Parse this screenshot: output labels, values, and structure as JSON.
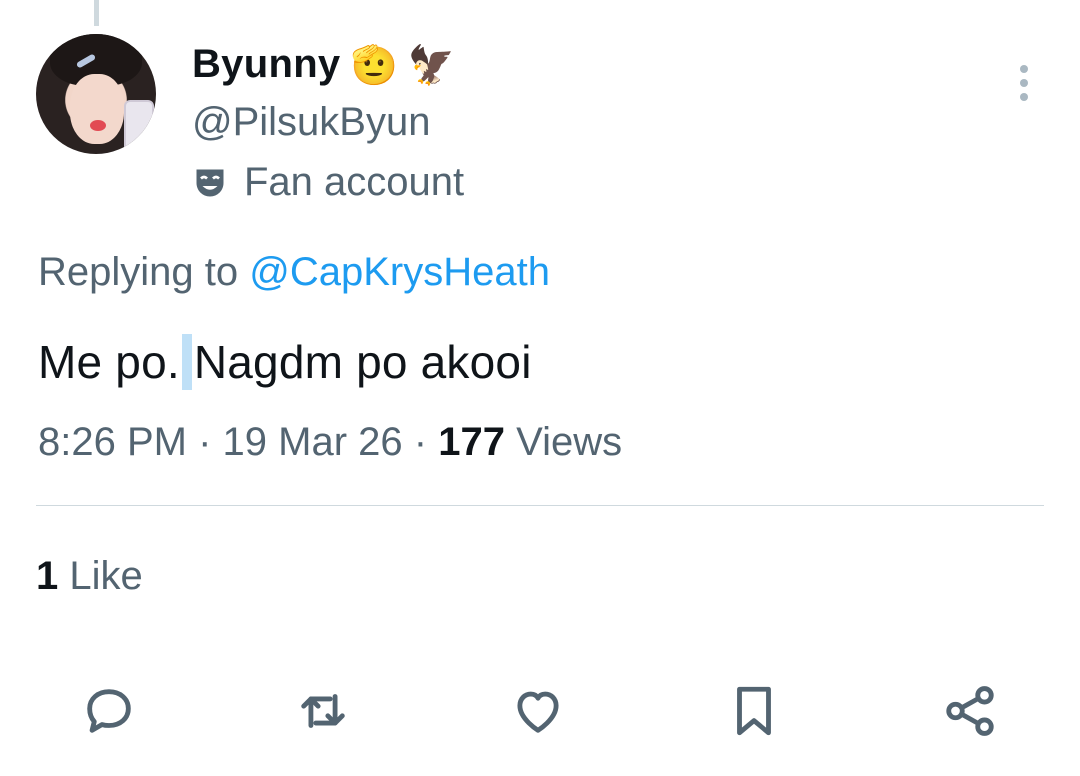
{
  "author": {
    "display_name": "Byunny",
    "name_emojis": [
      "🫡",
      "🦅"
    ],
    "handle": "@PilsukByun",
    "label_icon": "theater-mask-icon",
    "label": "Fan account"
  },
  "tweet": {
    "replying_prefix": "Replying to",
    "replying_to": "@CapKrysHeath",
    "text_before": "Me po.",
    "text_after": "Nagdm po akooi",
    "time": "8:26 PM",
    "separator": "·",
    "date": "19 Mar 26",
    "views_count": "177",
    "views_label": "Views"
  },
  "engagement": {
    "likes_count": "1",
    "likes_label": "Like"
  },
  "actions": [
    {
      "name": "reply",
      "icon": "reply-icon"
    },
    {
      "name": "retweet",
      "icon": "retweet-icon"
    },
    {
      "name": "like",
      "icon": "heart-icon"
    },
    {
      "name": "bookmark",
      "icon": "bookmark-icon"
    },
    {
      "name": "share",
      "icon": "share-icon"
    }
  ],
  "colors": {
    "text_primary": "#0f1419",
    "text_secondary": "#536471",
    "link": "#1d9bf0",
    "divider": "#cfd9de"
  }
}
